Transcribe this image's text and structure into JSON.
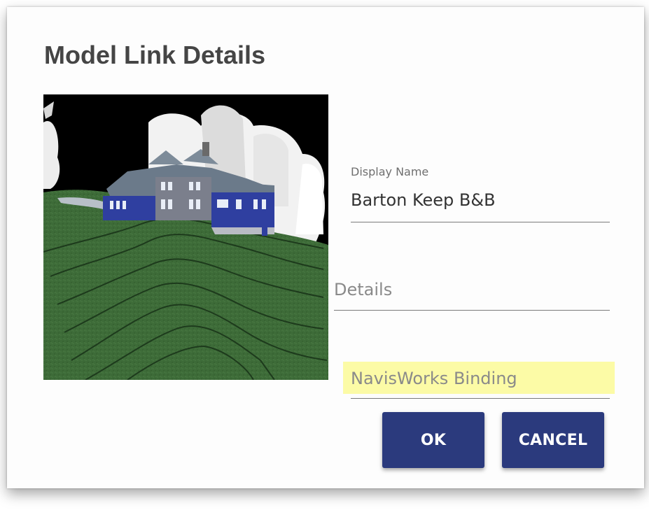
{
  "dialog": {
    "title": "Model Link Details"
  },
  "preview": {
    "image_icon": "model-preview-image"
  },
  "fields": {
    "display_name": {
      "label": "Display Name",
      "value": "Barton Keep B&B"
    },
    "details": {
      "placeholder": "Details",
      "value": ""
    },
    "navisworks_binding": {
      "placeholder": "NavisWorks Binding",
      "value": ""
    }
  },
  "buttons": {
    "ok_label": "OK",
    "cancel_label": "CANCEL"
  },
  "colors": {
    "button_bg": "#2b3a7d",
    "highlight": "#fcfba6",
    "title": "#454545"
  }
}
